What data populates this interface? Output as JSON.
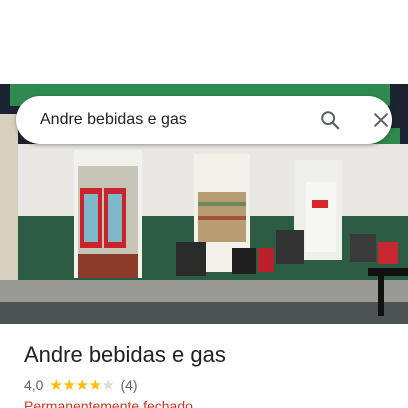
{
  "search": {
    "query": "Andre bebidas e gas",
    "search_icon": "search-icon",
    "close_icon": "close-icon"
  },
  "place": {
    "name": "Andre bebidas e gas",
    "rating_text": "4,0",
    "rating": 4,
    "max_rating": 5,
    "review_count_text": "(4)",
    "status": "Permanentemente fechado"
  },
  "colors": {
    "star_filled": "#fbbc04",
    "star_empty": "#dadce0",
    "status_closed": "#d93025",
    "storefront_green": "#2f6b45"
  }
}
